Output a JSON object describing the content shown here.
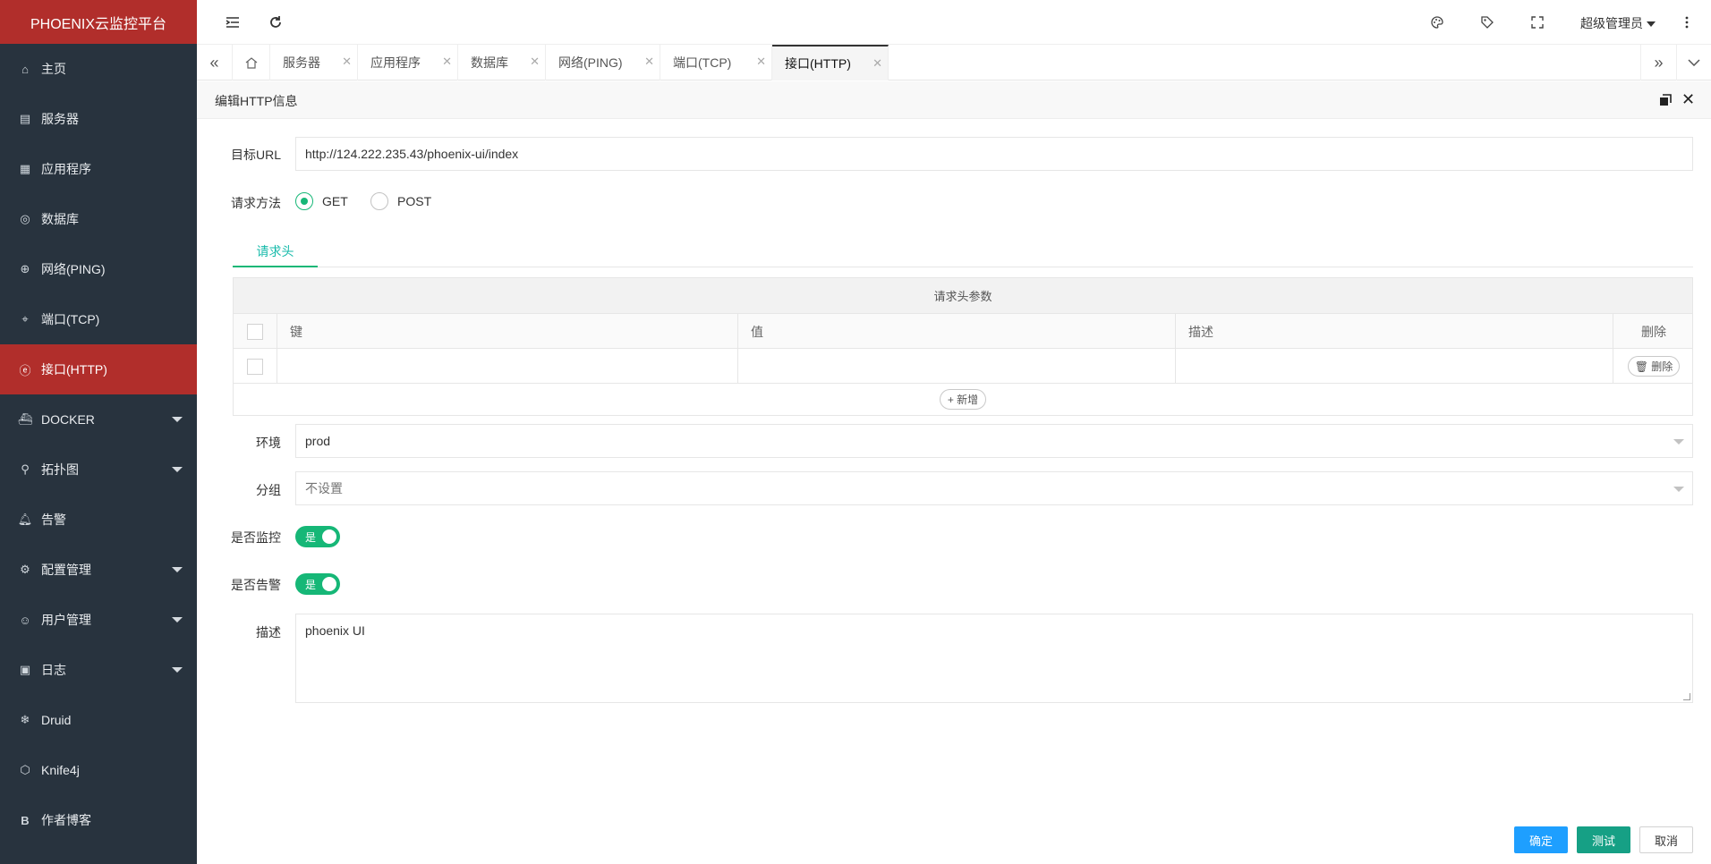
{
  "app": {
    "title": "PHOENIX云监控平台"
  },
  "sidebar": {
    "items": [
      {
        "label": "主页",
        "icon": "home-icon"
      },
      {
        "label": "服务器",
        "icon": "server-icon"
      },
      {
        "label": "应用程序",
        "icon": "apps-icon"
      },
      {
        "label": "数据库",
        "icon": "database-icon"
      },
      {
        "label": "网络(PING)",
        "icon": "globe-icon"
      },
      {
        "label": "端口(TCP)",
        "icon": "port-icon"
      },
      {
        "label": "接口(HTTP)",
        "icon": "ie-icon",
        "active": true
      },
      {
        "label": "DOCKER",
        "icon": "docker-icon",
        "expandable": true
      },
      {
        "label": "拓扑图",
        "icon": "topology-icon",
        "expandable": true
      },
      {
        "label": "告警",
        "icon": "bell-icon"
      },
      {
        "label": "配置管理",
        "icon": "gear-icon",
        "expandable": true
      },
      {
        "label": "用户管理",
        "icon": "user-icon",
        "expandable": true
      },
      {
        "label": "日志",
        "icon": "log-icon",
        "expandable": true
      },
      {
        "label": "Druid",
        "icon": "snowflake-icon"
      },
      {
        "label": "Knife4j",
        "icon": "cube-icon"
      },
      {
        "label": "作者博客",
        "icon": "blog-icon"
      }
    ]
  },
  "header": {
    "user": "超级管理员"
  },
  "tabs": [
    {
      "label": "服务器"
    },
    {
      "label": "应用程序"
    },
    {
      "label": "数据库"
    },
    {
      "label": "网络(PING)"
    },
    {
      "label": "端口(TCP)"
    },
    {
      "label": "接口(HTTP)",
      "active": true
    }
  ],
  "dialog": {
    "title": "编辑HTTP信息"
  },
  "form": {
    "url_label": "目标URL",
    "url_value": "http://124.222.235.43/phoenix-ui/index",
    "method_label": "请求方法",
    "method_get": "GET",
    "method_post": "POST",
    "method_selected": "GET",
    "subtab": "请求头",
    "table": {
      "caption": "请求头参数",
      "headers": [
        "键",
        "值",
        "描述",
        "删除"
      ],
      "delete_btn": "删除",
      "add_btn": "新增"
    },
    "env_label": "环境",
    "env_value": "prod",
    "group_label": "分组",
    "group_placeholder": "不设置",
    "monitor_label": "是否监控",
    "monitor_value": "是",
    "alarm_label": "是否告警",
    "alarm_value": "是",
    "desc_label": "描述",
    "desc_value": "phoenix UI"
  },
  "buttons": {
    "confirm": "确定",
    "test": "测试",
    "cancel": "取消"
  }
}
